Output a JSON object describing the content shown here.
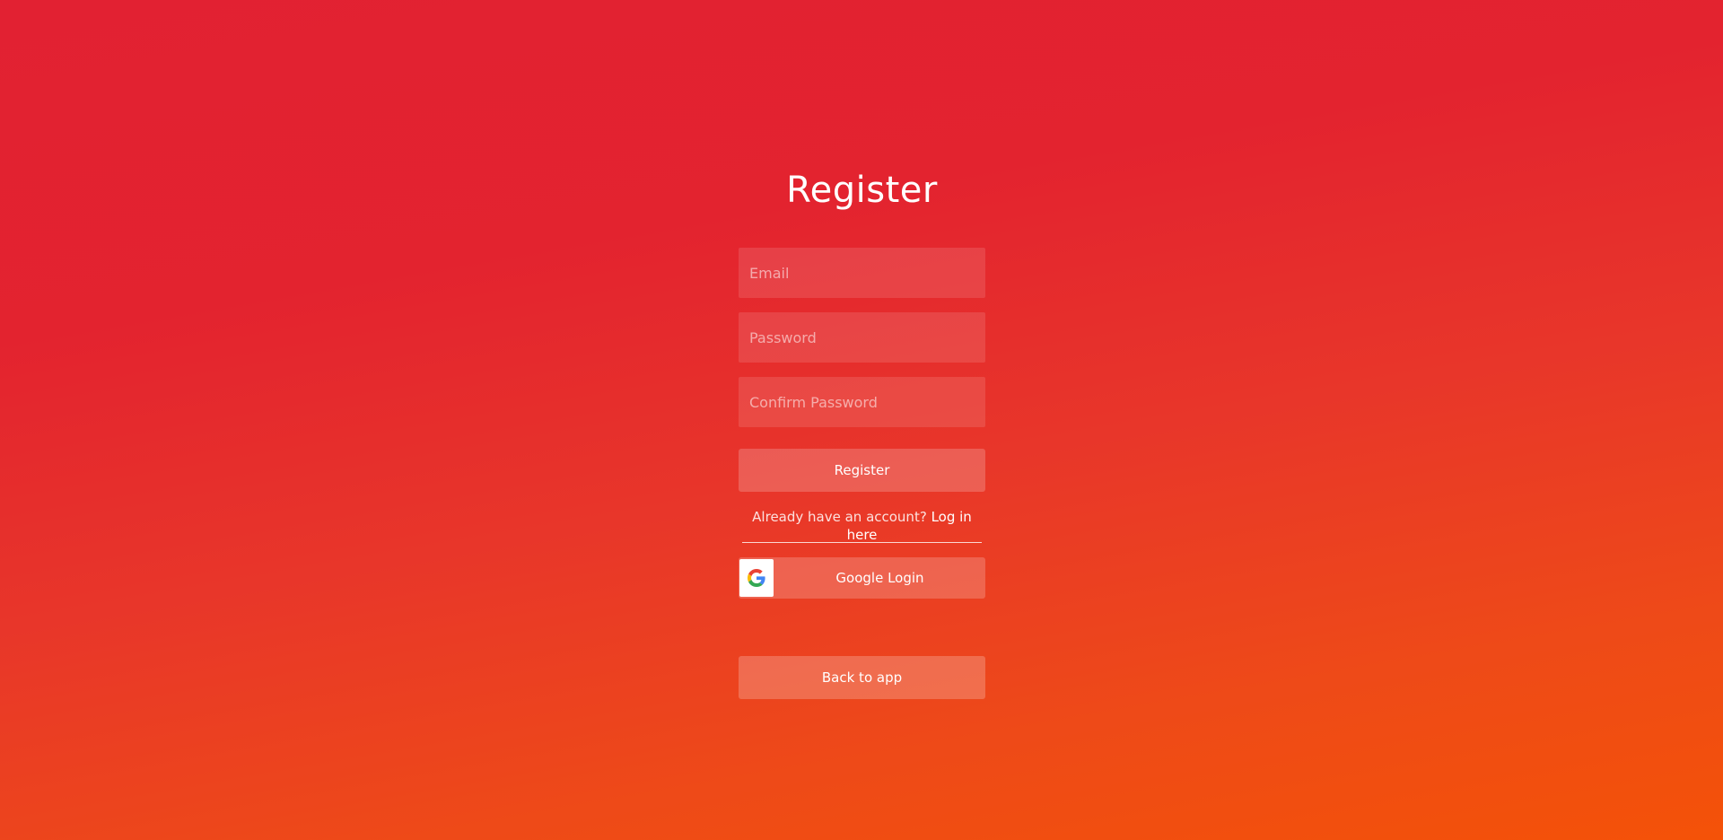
{
  "page": {
    "title": "Register"
  },
  "form": {
    "email_placeholder": "Email",
    "password_placeholder": "Password",
    "confirm_password_placeholder": "Confirm Password",
    "register_button_label": "Register"
  },
  "account_prompt": {
    "text": "Already have an account?",
    "link_label": "Log in here"
  },
  "google": {
    "button_label": "Google Login",
    "icon": "google-icon"
  },
  "back": {
    "button_label": "Back to app"
  },
  "colors": {
    "gradient_top": "#e22132",
    "gradient_bottom": "#f45208",
    "text": "#ffffff"
  }
}
